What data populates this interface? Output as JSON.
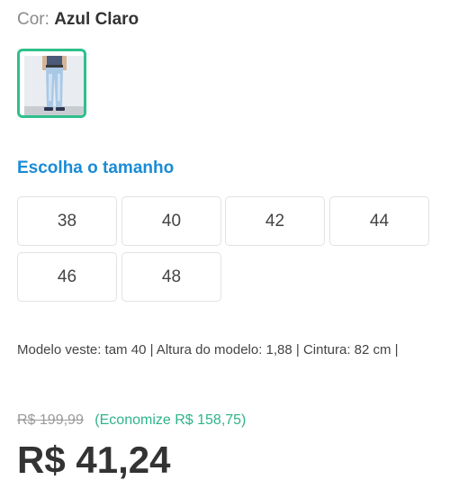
{
  "product": {
    "color_label": "Cor:",
    "color_value": "Azul Claro",
    "size_title": "Escolha o tamanho",
    "sizes": [
      "38",
      "40",
      "42",
      "44",
      "46",
      "48"
    ],
    "model_info": "Modelo veste: tam 40 | Altura do modelo: 1,88 | Cintura: 82 cm |",
    "old_price": "R$ 199,99",
    "savings": "(Economize R$ 158,75)",
    "price": "R$ 41,24"
  },
  "colors": {
    "accent_blue": "#1a8bd6",
    "selected_border": "#2fc08c",
    "savings_green": "#2fb38a"
  }
}
